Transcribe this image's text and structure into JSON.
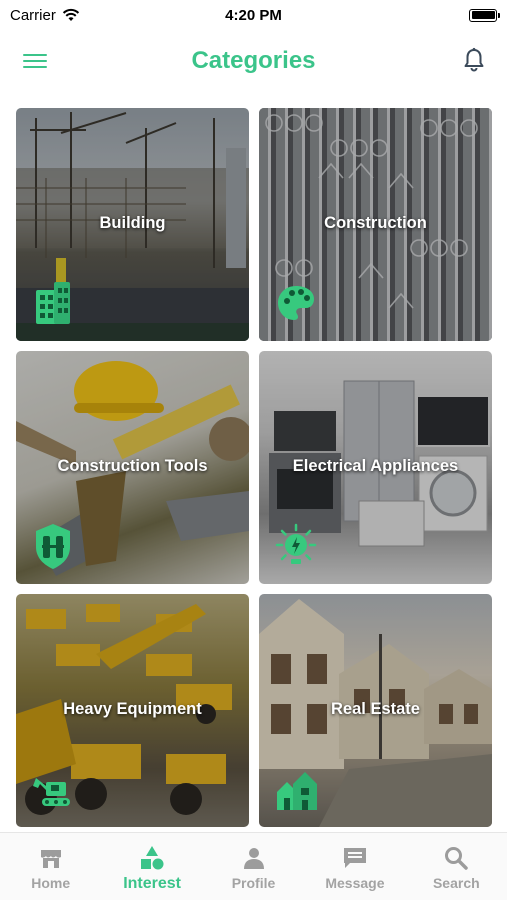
{
  "status_bar": {
    "carrier": "Carrier",
    "time": "4:20 PM"
  },
  "header": {
    "title": "Categories"
  },
  "categories": [
    {
      "label": "Building",
      "icon": "building-icon"
    },
    {
      "label": "Construction",
      "icon": "palette-icon"
    },
    {
      "label": "Construction Tools",
      "icon": "tools-badge-icon"
    },
    {
      "label": "Electrical Appliances",
      "icon": "lightbulb-icon"
    },
    {
      "label": "Heavy Equipment",
      "icon": "excavator-icon"
    },
    {
      "label": "Real Estate",
      "icon": "houses-icon"
    }
  ],
  "tab_bar": {
    "active": "Interest",
    "tabs": [
      {
        "label": "Home",
        "icon": "store-icon"
      },
      {
        "label": "Interest",
        "icon": "shapes-icon"
      },
      {
        "label": "Profile",
        "icon": "person-icon"
      },
      {
        "label": "Message",
        "icon": "chat-icon"
      },
      {
        "label": "Search",
        "icon": "search-icon"
      }
    ]
  },
  "colors": {
    "accent": "#3bc48a",
    "inactive": "#a3a3a3"
  }
}
